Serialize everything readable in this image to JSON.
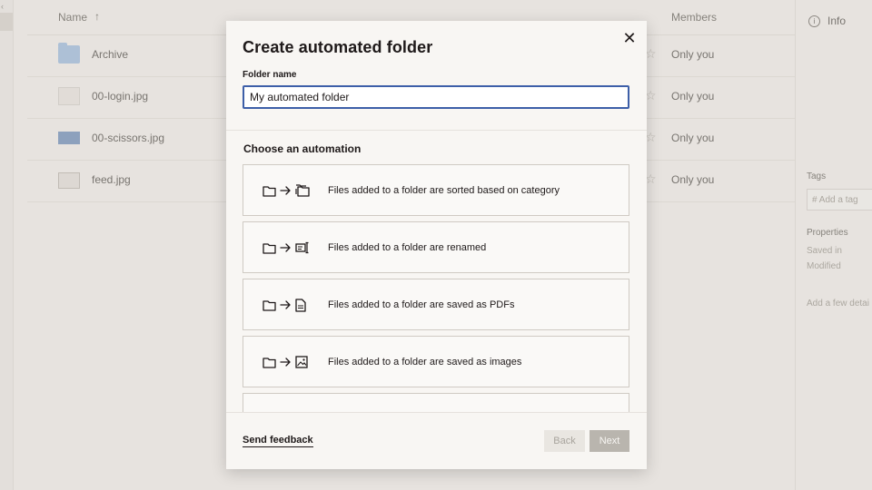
{
  "background": {
    "list_header": {
      "name_label": "Name",
      "sort_arrow": "↑",
      "members_label": "Members"
    },
    "files": [
      {
        "name": "Archive",
        "thumb_icon": "folder-icon",
        "members": "Only you"
      },
      {
        "name": "00-login.jpg",
        "thumb_icon": "image-thumbnail",
        "members": "Only you"
      },
      {
        "name": "00-scissors.jpg",
        "thumb_icon": "image-thumbnail",
        "members": "Only you"
      },
      {
        "name": "feed.jpg",
        "thumb_icon": "image-thumbnail",
        "members": "Only you"
      }
    ],
    "right_panel": {
      "info_label": "Info",
      "tags_label": "Tags",
      "add_tag_placeholder": "# Add a tag",
      "properties_label": "Properties",
      "saved_in_label": "Saved in",
      "modified_label": "Modified",
      "description_placeholder": "Add a few detai"
    }
  },
  "modal": {
    "title": "Create automated folder",
    "close_icon": "close-icon",
    "folder_name_label": "Folder name",
    "folder_name_value": "My automated folder",
    "section_title": "Choose an automation",
    "options": [
      {
        "label": "Files added to a folder are sorted based on category",
        "icons": [
          "folder-icon",
          "arrow-right-icon",
          "folders-icon"
        ]
      },
      {
        "label": "Files added to a folder are renamed",
        "icons": [
          "folder-icon",
          "arrow-right-icon",
          "rename-icon"
        ]
      },
      {
        "label": "Files added to a folder are saved as PDFs",
        "icons": [
          "folder-icon",
          "arrow-right-icon",
          "pdf-file-icon"
        ]
      },
      {
        "label": "Files added to a folder are saved as images",
        "icons": [
          "folder-icon",
          "arrow-right-icon",
          "image-icon"
        ]
      }
    ],
    "feedback_label": "Send feedback",
    "back_label": "Back",
    "next_label": "Next"
  },
  "colors": {
    "modal_bg": "#f8f6f3",
    "input_focus_border": "#3d5fa8",
    "text_primary": "#1e1919",
    "next_button_disabled": "#b9b5ae",
    "back_button_disabled": "#e9e6e1"
  }
}
